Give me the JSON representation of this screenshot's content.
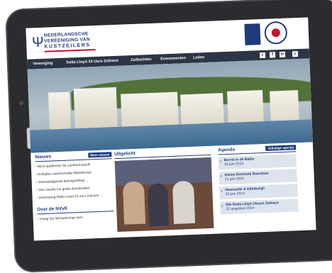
{
  "logo": {
    "line1": "NEDERLANDSCHE",
    "line2": "VEREENIGING VAN",
    "line3": "KUSTZEILERS"
  },
  "nav": {
    "items": [
      "Vereniging",
      "Delta Lloyd 24 Uurs Zeilrace",
      "Zeiltochten",
      "Evenementen",
      "Leden"
    ],
    "social": [
      "twitter-icon",
      "facebook-icon",
      "linkedin-icon",
      "search-icon"
    ]
  },
  "colors": {
    "brand": "#1d3a7a",
    "nav_bg": "#2c3545",
    "accent": "#c8102e",
    "agenda_item_bg": "#dde4ec"
  },
  "nieuws": {
    "title": "Nieuws",
    "more": "Meer nieuws",
    "items": [
      "Blind spelbreker bij Lambertustocht",
      "Actieplan vaarrecreatie Waddenzee",
      "Overweldigende belangstelling ...",
      "Den nareke los gratis downloaden",
      "Inschrijving Delta Lloyd 24 uurs Zeilrace ..."
    ]
  },
  "over": {
    "title": "Over de NVvK",
    "items": [
      "Vraag het lidmaatschap aan!"
    ]
  },
  "uitgelicht": {
    "title": "Uitgelicht"
  },
  "agenda": {
    "title": "Agenda",
    "more": "Volledige agenda",
    "items": [
      {
        "title": "Borrel in de Baltic",
        "date": "19 juni 2014"
      },
      {
        "title": "Kleine Driehoek Noordzee",
        "date": "21 juni 2014"
      },
      {
        "title": "Newcastle & Edinburgh",
        "date": "23 juni 2014"
      },
      {
        "title": "50e Delta Lloyd 24uurs Zeilrace",
        "date": "22 augustus 2014"
      }
    ]
  }
}
